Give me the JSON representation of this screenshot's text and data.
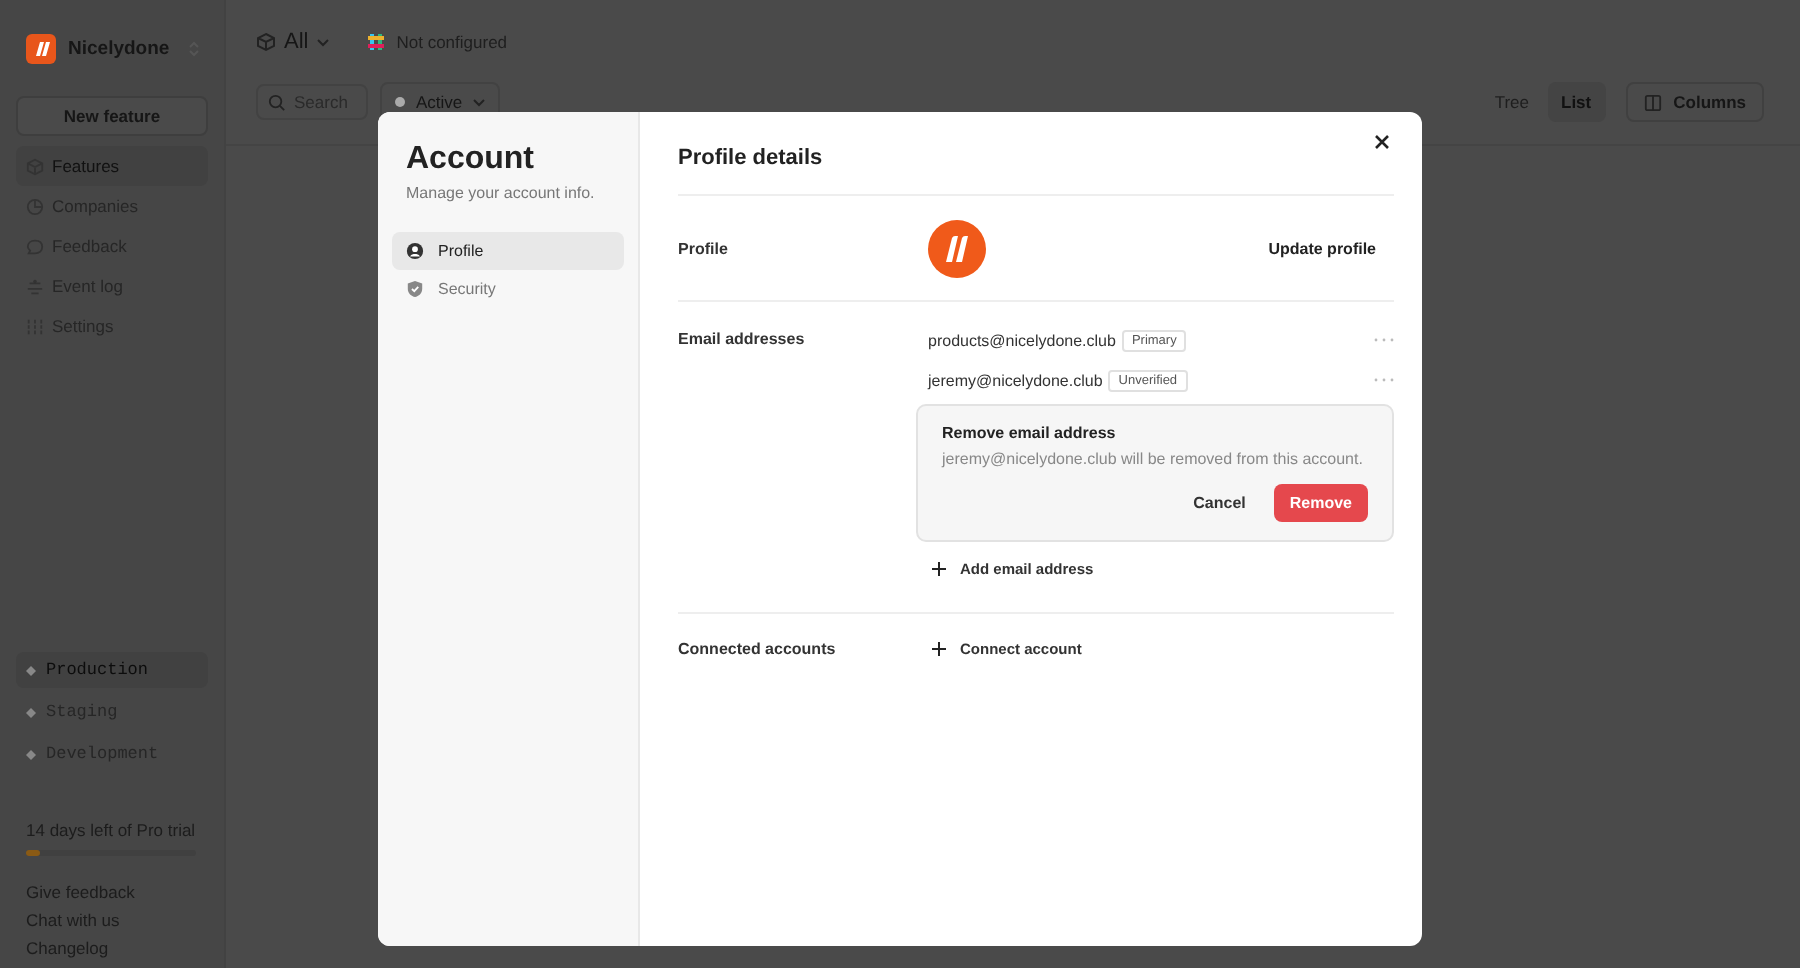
{
  "sidebar": {
    "workspace": "Nicelydone",
    "new_button": "New feature",
    "nav": [
      {
        "label": "Features",
        "selected": true
      },
      {
        "label": "Companies",
        "selected": false
      },
      {
        "label": "Feedback",
        "selected": false
      },
      {
        "label": "Event log",
        "selected": false
      },
      {
        "label": "Settings",
        "selected": false
      }
    ],
    "environments": [
      {
        "label": "Production",
        "selected": true
      },
      {
        "label": "Staging",
        "selected": false
      },
      {
        "label": "Development",
        "selected": false
      }
    ],
    "trial": {
      "text": "14 days left of Pro trial",
      "level": 0.08
    },
    "footer_links": [
      "Give feedback",
      "Chat with us",
      "Changelog"
    ]
  },
  "toolbar": {
    "scope": "All",
    "integration": "Not configured",
    "search_placeholder": "Search",
    "filter": "Active",
    "views": [
      {
        "label": "Tree",
        "selected": false
      },
      {
        "label": "List",
        "selected": true
      }
    ],
    "columns_button": "Columns"
  },
  "modal": {
    "title": "Account",
    "subtitle": "Manage your account info.",
    "tabs": [
      {
        "label": "Profile",
        "selected": true
      },
      {
        "label": "Security",
        "selected": false
      }
    ],
    "heading": "Profile details",
    "profile_label": "Profile",
    "update_button": "Update profile",
    "emails_label": "Email addresses",
    "emails": [
      {
        "address": "products@nicelydone.club",
        "badge": "Primary"
      },
      {
        "address": "jeremy@nicelydone.club",
        "badge": "Unverified"
      }
    ],
    "confirm": {
      "title": "Remove email address",
      "message": "jeremy@nicelydone.club will be removed from this account.",
      "cancel": "Cancel",
      "remove": "Remove"
    },
    "add_email": "Add email address",
    "connected_label": "Connected accounts",
    "connect_button": "Connect account"
  }
}
